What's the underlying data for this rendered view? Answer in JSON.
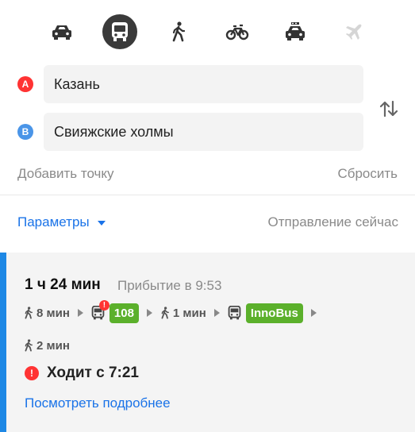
{
  "transport_modes": [
    {
      "id": "car",
      "icon": "car-icon",
      "active": false
    },
    {
      "id": "bus",
      "icon": "bus-icon",
      "active": true
    },
    {
      "id": "walk",
      "icon": "walk-icon",
      "active": false
    },
    {
      "id": "bike",
      "icon": "bike-icon",
      "active": false
    },
    {
      "id": "taxi",
      "icon": "taxi-icon",
      "active": false
    },
    {
      "id": "plane",
      "icon": "plane-icon",
      "active": false,
      "disabled": true
    }
  ],
  "route": {
    "point_a": {
      "marker": "A",
      "value": "Казань"
    },
    "point_b": {
      "marker": "B",
      "value": "Свияжские холмы"
    },
    "add_point_label": "Добавить точку",
    "reset_label": "Сбросить"
  },
  "params": {
    "label": "Параметры",
    "departure_label": "Отправление сейчас"
  },
  "result": {
    "duration": "1 ч 24 мин",
    "arrival": "Прибытие в 9:53",
    "steps": {
      "walk1": "8 мин",
      "bus1_route": "108",
      "walk2": "1 мин",
      "bus2_route": "InnoBus",
      "walk3": "2 мин"
    },
    "alert_mark": "!",
    "schedule_note": "Ходит с 7:21",
    "details_label": "Посмотреть подробнее"
  },
  "colors": {
    "accent_blue": "#1a73e8",
    "card_accent": "#1e88e5",
    "route_badge_green": "#5bb02b",
    "marker_a": "#ff3333",
    "marker_b": "#4a95e8",
    "alert_red": "#ff3333"
  }
}
